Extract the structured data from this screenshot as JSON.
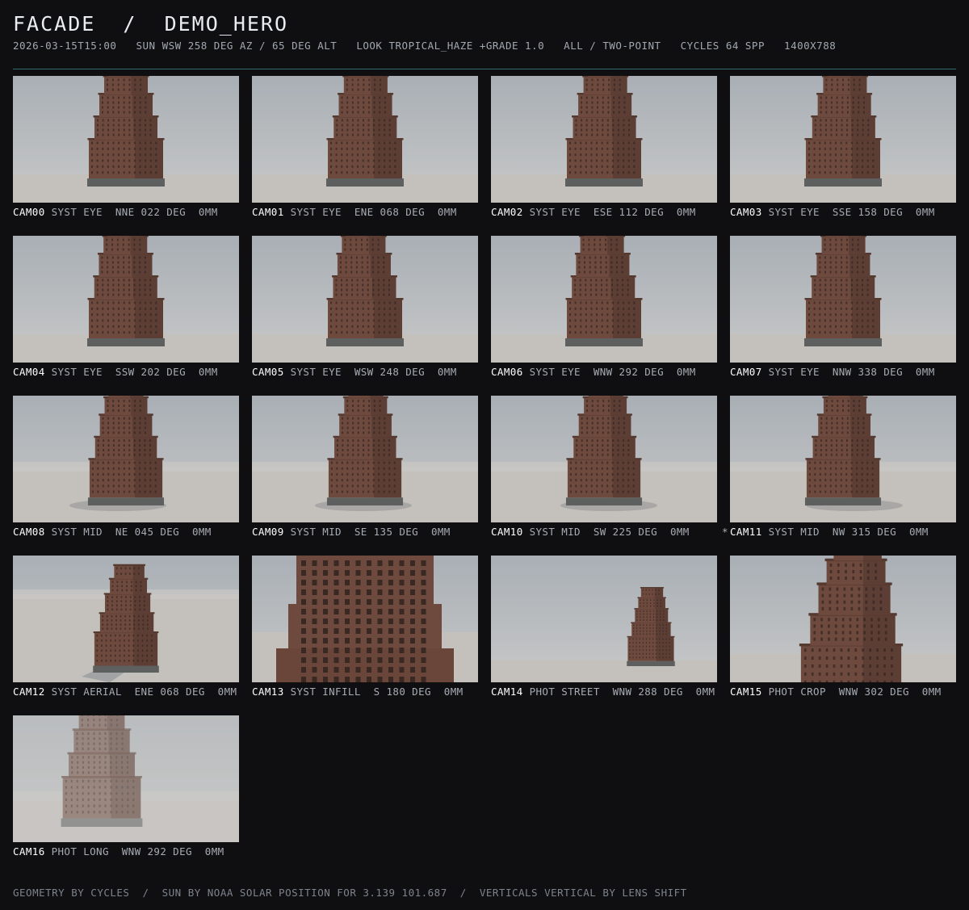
{
  "header": {
    "title": "FACADE  /  DEMO_HERO",
    "meta": "2026-03-15T15:00   SUN WSW 258 DEG AZ / 65 DEG ALT   LOOK TROPICAL_HAZE +GRADE 1.0   ALL / TWO-POINT   CYCLES 64 SPP   1400X788"
  },
  "cameras": [
    {
      "cam": "CAM00",
      "desc": "SYST EYE  NNE 022 DEG  0MM",
      "type": "eye",
      "var": 0
    },
    {
      "cam": "CAM01",
      "desc": "SYST EYE  ENE 068 DEG  0MM",
      "type": "eye",
      "var": 1
    },
    {
      "cam": "CAM02",
      "desc": "SYST EYE  ESE 112 DEG  0MM",
      "type": "eye",
      "var": 2
    },
    {
      "cam": "CAM03",
      "desc": "SYST EYE  SSE 158 DEG  0MM",
      "type": "eye",
      "var": 3
    },
    {
      "cam": "CAM04",
      "desc": "SYST EYE  SSW 202 DEG  0MM",
      "type": "eye",
      "var": 4
    },
    {
      "cam": "CAM05",
      "desc": "SYST EYE  WSW 248 DEG  0MM",
      "type": "eye",
      "var": 5
    },
    {
      "cam": "CAM06",
      "desc": "SYST EYE  WNW 292 DEG  0MM",
      "type": "eye",
      "var": 6
    },
    {
      "cam": "CAM07",
      "desc": "SYST EYE  NNW 338 DEG  0MM",
      "type": "eye",
      "var": 7
    },
    {
      "cam": "CAM08",
      "desc": "SYST MID  NE 045 DEG  0MM",
      "type": "mid",
      "var": 0
    },
    {
      "cam": "CAM09",
      "desc": "SYST MID  SE 135 DEG  0MM",
      "type": "mid",
      "var": 1
    },
    {
      "cam": "CAM10",
      "desc": "SYST MID  SW 225 DEG  0MM",
      "type": "mid",
      "var": 2
    },
    {
      "cam": "CAM11",
      "desc": "SYST MID  NW 315 DEG  0MM",
      "type": "mid",
      "var": 3,
      "marked": true
    },
    {
      "cam": "CAM12",
      "desc": "SYST AERIAL  ENE 068 DEG  0MM",
      "type": "aerial",
      "var": 0
    },
    {
      "cam": "CAM13",
      "desc": "SYST INFILL  S 180 DEG  0MM",
      "type": "infill",
      "var": 0
    },
    {
      "cam": "CAM14",
      "desc": "PHOT STREET  WNW 288 DEG  0MM",
      "type": "street",
      "var": 0
    },
    {
      "cam": "CAM15",
      "desc": "PHOT CROP  WNW 302 DEG  0MM",
      "type": "crop",
      "var": 0
    },
    {
      "cam": "CAM16",
      "desc": "PHOT LONG  WNW 292 DEG  0MM",
      "type": "long",
      "var": 0
    }
  ],
  "mark_symbol": "*",
  "footer": "GEOMETRY BY CYCLES  /  SUN BY NOAA SOLAR POSITION FOR 3.139 101.687  /  VERTICALS VERTICAL BY LENS SHIFT",
  "colors": {
    "accent_rule": "#2f6e6a",
    "brick": "#6e4a3e",
    "brick_dark": "#4e352d",
    "base": "#5e5f5f",
    "sky": "#b9bdc1",
    "ground": "#c4c1bc"
  }
}
